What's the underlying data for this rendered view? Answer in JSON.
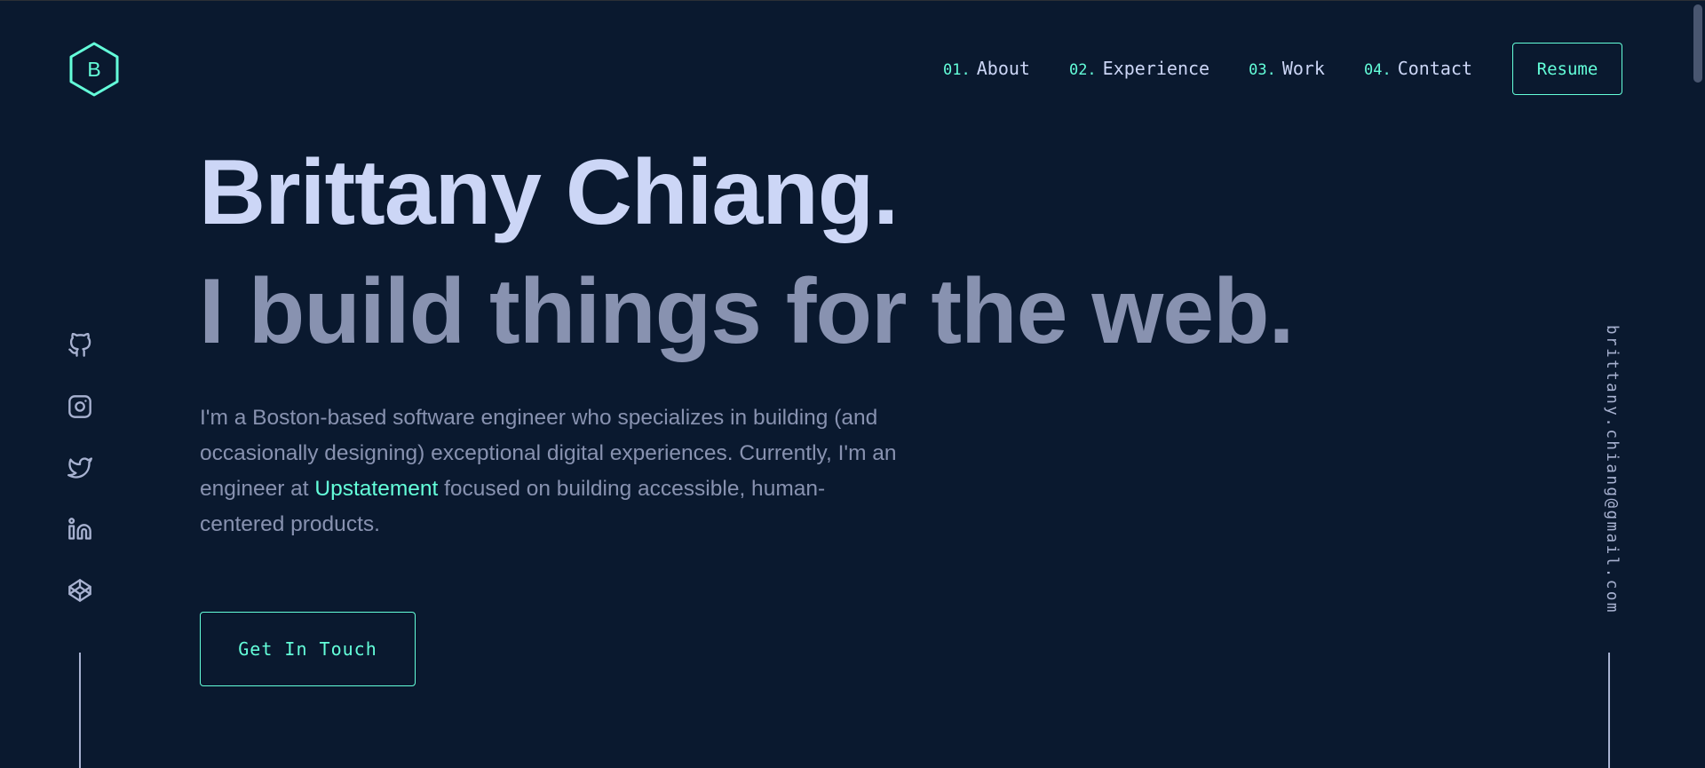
{
  "logo": {
    "letter": "B",
    "icon": "hexagon-logo-icon"
  },
  "nav": {
    "items": [
      {
        "num": "01.",
        "label": "About"
      },
      {
        "num": "02.",
        "label": "Experience"
      },
      {
        "num": "03.",
        "label": "Work"
      },
      {
        "num": "04.",
        "label": "Contact"
      }
    ],
    "resume_label": "Resume"
  },
  "hero": {
    "name": "Brittany Chiang.",
    "tagline": "I build things for the web.",
    "desc_1": "I'm a Boston-based software engineer who specializes in building (and occasionally designing) exceptional digital experiences. Currently, I'm an engineer at ",
    "desc_link": "Upstatement",
    "desc_2": " focused on building accessible, human-centered products.",
    "cta_label": "Get In Touch"
  },
  "socials": [
    "github-icon",
    "instagram-icon",
    "twitter-icon",
    "linkedin-icon",
    "codepen-icon"
  ],
  "email": "brittany.chiang@gmail.com",
  "colors": {
    "background": "#0a192f",
    "accent": "#64ffda",
    "heading": "#ccd6f6",
    "text": "#8892b0"
  }
}
